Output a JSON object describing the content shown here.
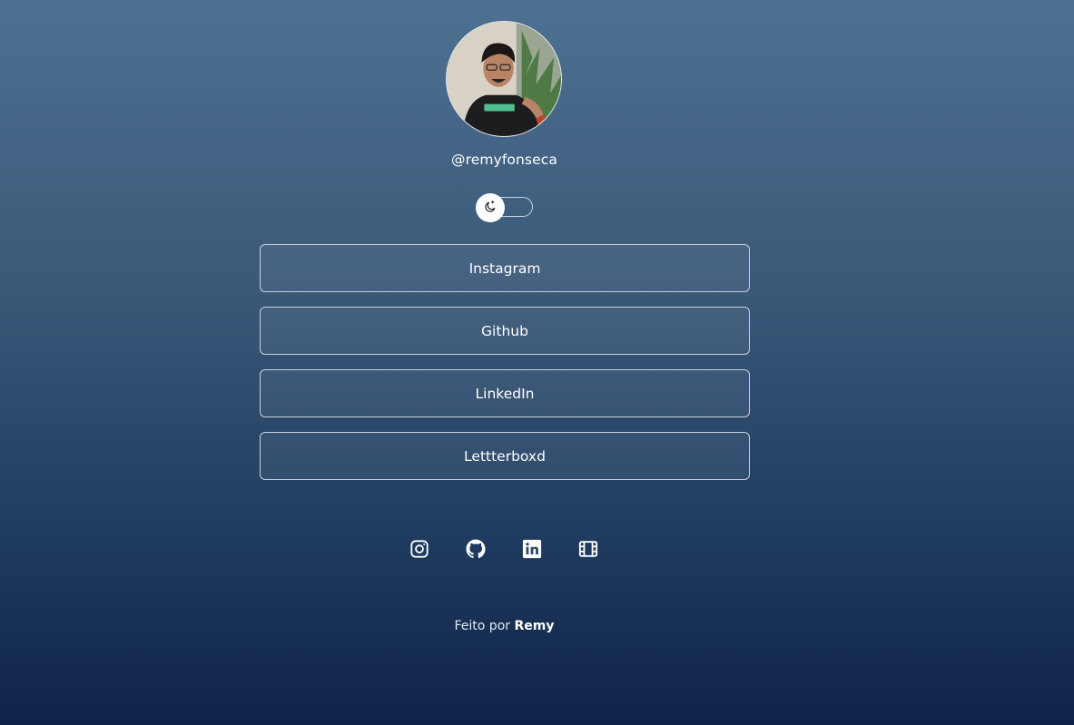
{
  "profile": {
    "username": "@remyfonseca",
    "avatar_icon": "profile-photo"
  },
  "theme_toggle": {
    "icon": "moon-icon",
    "state": "off"
  },
  "links": [
    {
      "label": "Instagram"
    },
    {
      "label": "Github"
    },
    {
      "label": "LinkedIn"
    },
    {
      "label": "Lettterboxd"
    }
  ],
  "social_icons": [
    "instagram-icon",
    "github-icon",
    "linkedin-icon",
    "film-icon"
  ],
  "footer": {
    "prefix": "Feito por",
    "author": "Remy"
  },
  "colors": {
    "background_top": "#4d7192",
    "background_bottom": "#0e2347",
    "text": "#ffffff",
    "button_border": "#c7d0da"
  }
}
